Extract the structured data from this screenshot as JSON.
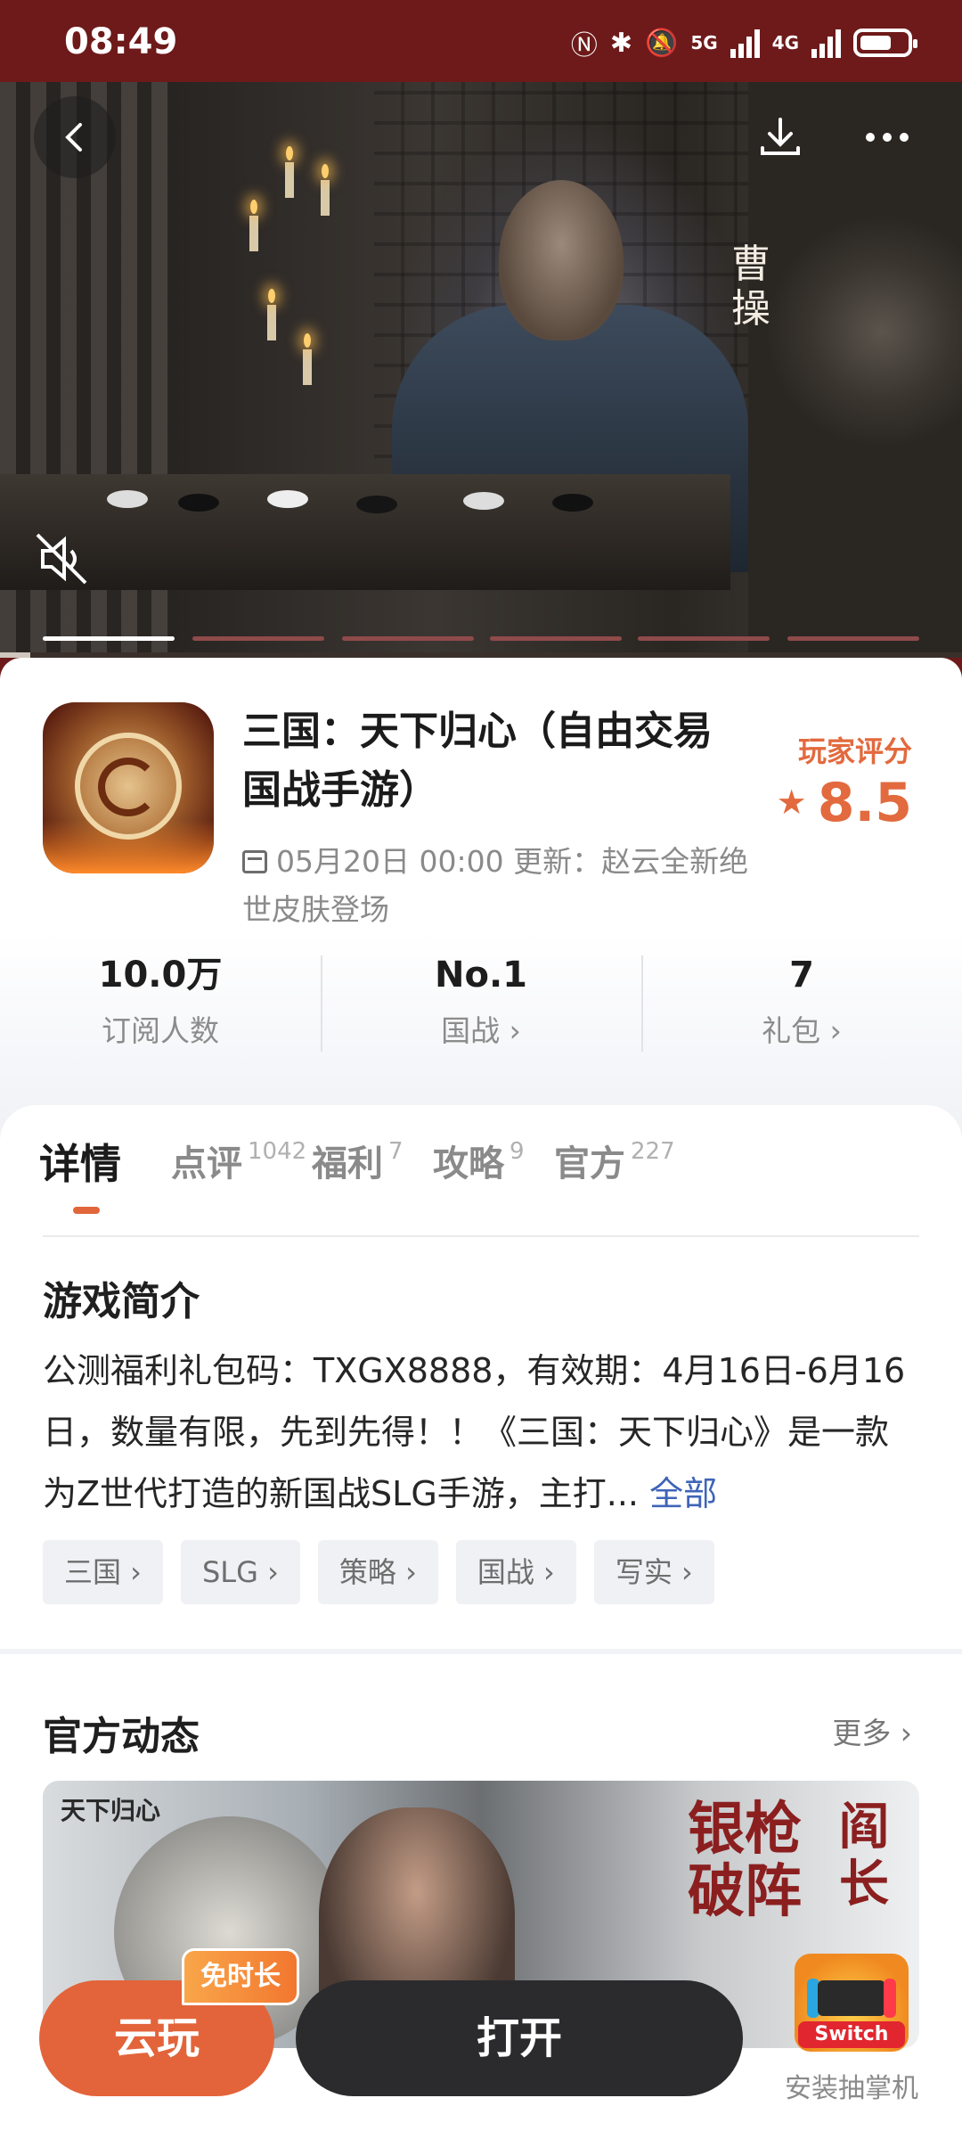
{
  "status_bar": {
    "time": "08:49",
    "net1": "5G",
    "net2": "4G"
  },
  "hero": {
    "character_label": "曹操"
  },
  "app": {
    "title": "三国：天下归心（自由交易国战手游）",
    "update_text": "05月20日 00:00 更新：赵云全新绝世皮肤登场",
    "rating_label": "玩家评分",
    "rating_value": "8.5",
    "rating_star": "★"
  },
  "stats": [
    {
      "value": "10.0万",
      "label": "订阅人数"
    },
    {
      "value": "No.1",
      "label": "国战 ›"
    },
    {
      "value": "7",
      "label": "礼包 ›"
    }
  ],
  "tabs": [
    {
      "label": "详情",
      "count": ""
    },
    {
      "label": "点评",
      "count": "1042"
    },
    {
      "label": "福利",
      "count": "7"
    },
    {
      "label": "攻略",
      "count": "9"
    },
    {
      "label": "官方",
      "count": "227"
    }
  ],
  "intro": {
    "title": "游戏简介",
    "text": "公测福利礼包码：TXGX8888，有效期：4月16日-6月16日，数量有限，先到先得！！《三国：天下归心》是一款为Z世代打造的新国战SLG手游，主打...",
    "more": "全部"
  },
  "tags": [
    "三国 ›",
    "SLG ›",
    "策略 ›",
    "国战 ›",
    "写实 ›"
  ],
  "official": {
    "title": "官方动态",
    "more": "更多 ›",
    "banner_logo": "天下归心",
    "banner_text": "银枪破阵",
    "banner_side": "阎长"
  },
  "bottom": {
    "cloud_play": "云玩",
    "free_badge": "免时长",
    "open": "打开",
    "switch_badge": "Switch",
    "switch_caption": "安装抽掌机"
  },
  "colors": {
    "accent": "#e3643a",
    "brand_dark": "#6e1a1a",
    "link": "#3f64b8"
  }
}
